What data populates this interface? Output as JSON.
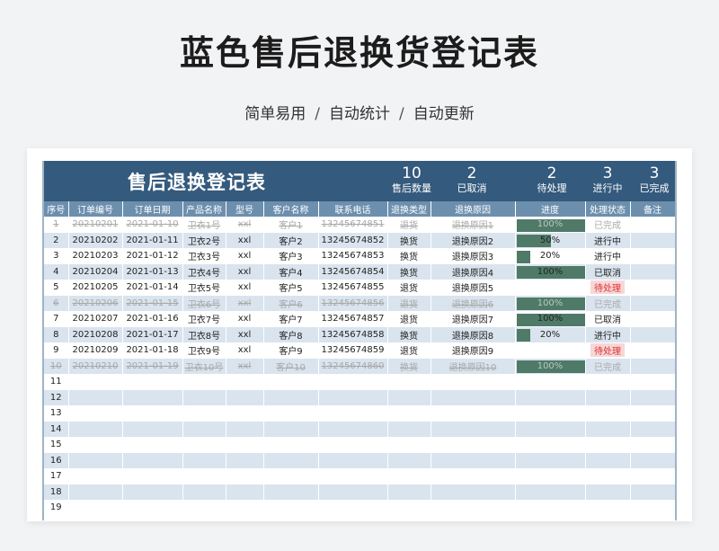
{
  "title": "蓝色售后退换货登记表",
  "subtitle": [
    "简单易用",
    "自动统计",
    "自动更新"
  ],
  "sheet_title": "售后退换登记表",
  "stats": [
    {
      "num": "10",
      "label": "售后数量"
    },
    {
      "num": "2",
      "label": "已取消"
    },
    {
      "num": "2",
      "label": "待处理"
    },
    {
      "num": "3",
      "label": "进行中"
    },
    {
      "num": "3",
      "label": "已完成"
    }
  ],
  "columns": [
    "序号",
    "订单编号",
    "订单日期",
    "产品名称",
    "型号",
    "客户名称",
    "联系电话",
    "退换类型",
    "退换原因",
    "进度",
    "处理状态",
    "备注"
  ],
  "rows": [
    {
      "no": "1",
      "order": "20210201",
      "date": "2021-01-10",
      "product": "卫衣1号",
      "model": "xxl",
      "customer": "客户1",
      "phone": "13245674851",
      "type": "退货",
      "reason": "退换原因1",
      "progress": 100,
      "status": "已完成",
      "note": ""
    },
    {
      "no": "2",
      "order": "20210202",
      "date": "2021-01-11",
      "product": "卫衣2号",
      "model": "xxl",
      "customer": "客户2",
      "phone": "13245674852",
      "type": "换货",
      "reason": "退换原因2",
      "progress": 50,
      "status": "进行中",
      "note": ""
    },
    {
      "no": "3",
      "order": "20210203",
      "date": "2021-01-12",
      "product": "卫衣3号",
      "model": "xxl",
      "customer": "客户3",
      "phone": "13245674853",
      "type": "换货",
      "reason": "退换原因3",
      "progress": 20,
      "status": "进行中",
      "note": ""
    },
    {
      "no": "4",
      "order": "20210204",
      "date": "2021-01-13",
      "product": "卫衣4号",
      "model": "xxl",
      "customer": "客户4",
      "phone": "13245674854",
      "type": "换货",
      "reason": "退换原因4",
      "progress": 100,
      "status": "已取消",
      "note": ""
    },
    {
      "no": "5",
      "order": "20210205",
      "date": "2021-01-14",
      "product": "卫衣5号",
      "model": "xxl",
      "customer": "客户5",
      "phone": "13245674855",
      "type": "退货",
      "reason": "退换原因5",
      "progress": null,
      "status": "待处理",
      "note": ""
    },
    {
      "no": "6",
      "order": "20210206",
      "date": "2021-01-15",
      "product": "卫衣6号",
      "model": "xxl",
      "customer": "客户6",
      "phone": "13245674856",
      "type": "退货",
      "reason": "退换原因6",
      "progress": 100,
      "status": "已完成",
      "note": ""
    },
    {
      "no": "7",
      "order": "20210207",
      "date": "2021-01-16",
      "product": "卫衣7号",
      "model": "xxl",
      "customer": "客户7",
      "phone": "13245674857",
      "type": "退货",
      "reason": "退换原因7",
      "progress": 100,
      "status": "已取消",
      "note": ""
    },
    {
      "no": "8",
      "order": "20210208",
      "date": "2021-01-17",
      "product": "卫衣8号",
      "model": "xxl",
      "customer": "客户8",
      "phone": "13245674858",
      "type": "换货",
      "reason": "退换原因8",
      "progress": 20,
      "status": "进行中",
      "note": ""
    },
    {
      "no": "9",
      "order": "20210209",
      "date": "2021-01-18",
      "product": "卫衣9号",
      "model": "xxl",
      "customer": "客户9",
      "phone": "13245674859",
      "type": "退货",
      "reason": "退换原因9",
      "progress": null,
      "status": "待处理",
      "note": ""
    },
    {
      "no": "10",
      "order": "20210210",
      "date": "2021-01-19",
      "product": "卫衣10号",
      "model": "xxl",
      "customer": "客户10",
      "phone": "13245674860",
      "type": "换货",
      "reason": "退换原因10",
      "progress": 100,
      "status": "已完成",
      "note": ""
    }
  ],
  "empty_rows": [
    "11",
    "12",
    "13",
    "14",
    "15",
    "16",
    "17",
    "18",
    "19"
  ],
  "colors": {
    "header": "#345a7d",
    "col_header": "#6d8fae",
    "band": "#d9e4ee",
    "bar": "#4f7a68",
    "wait": "#d33333"
  }
}
